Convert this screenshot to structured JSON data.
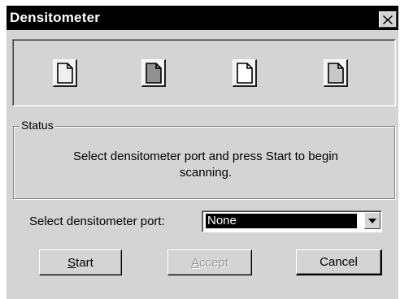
{
  "window": {
    "title": "Densitometer",
    "close_icon": "close-icon"
  },
  "icons": [
    {
      "name": "document-icon",
      "fill": "#f0f0f0"
    },
    {
      "name": "document-icon",
      "fill": "#909090"
    },
    {
      "name": "document-icon",
      "fill": "#ffffff"
    },
    {
      "name": "document-icon",
      "fill": "#c8c8c8"
    }
  ],
  "status": {
    "legend": "Status",
    "message_line1": "Select densitometer port and press Start to begin",
    "message_line2": "scanning."
  },
  "port": {
    "label": "Select densitometer port:",
    "selected": "None",
    "arrow_icon": "dropdown-arrow-icon"
  },
  "buttons": {
    "start_underlined": "S",
    "start_rest": "tart",
    "accept_underlined": "A",
    "accept_rest": "ccept",
    "accept_enabled": false,
    "cancel": "Cancel"
  },
  "colors": {
    "titlebar": "#000000",
    "dialog_bg": "#d4d4d4",
    "selection": "#000000",
    "disabled_text": "#9a9a9a"
  }
}
